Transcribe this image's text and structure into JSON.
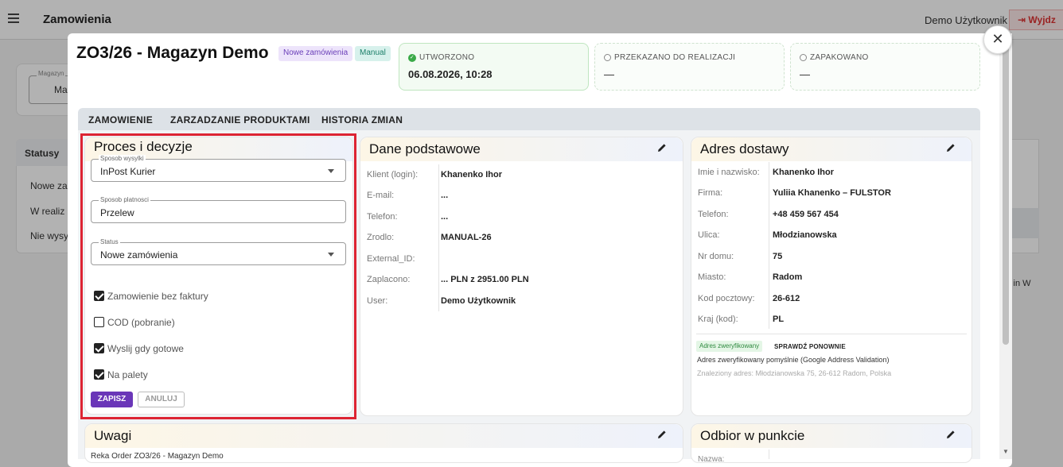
{
  "app": {
    "title": "Zamowienia",
    "user": "Demo Użytkownik",
    "logout": "Wyjdz",
    "bg_field_label": "Magazyn",
    "bg_field_value": "Ma",
    "statuses_title": "Statusy",
    "statuses": [
      "Nowe za",
      "W realiz",
      "Nie wysy"
    ],
    "bg_right_text": "ma d in W"
  },
  "modal": {
    "title": "ZO3/26 - Magazyn Demo",
    "chips": {
      "status": "Nowe zamówienia",
      "source": "Manual"
    },
    "close": "✕",
    "steps": [
      {
        "label": "UTWORZONO",
        "value": "06.08.2026, 10:28"
      },
      {
        "label": "PRZEKAZANO DO REALIZACJI",
        "value": "—"
      },
      {
        "label": "ZAPAKOWANO",
        "value": "—"
      }
    ],
    "tabs": [
      "ZAMOWIENIE",
      "ZARZADZANIE PRODUKTAMI",
      "HISTORIA ZMIAN"
    ]
  },
  "process": {
    "title": "Proces i decyzje",
    "shipping": {
      "label": "Sposob wysylki",
      "value": "InPost Kurier"
    },
    "payment": {
      "label": "Sposob platnosci",
      "value": "Przelew"
    },
    "status": {
      "label": "Status",
      "value": "Nowe zamówienia"
    },
    "checkboxes": [
      {
        "label": "Zamowienie bez faktury",
        "checked": true
      },
      {
        "label": "COD (pobranie)",
        "checked": false
      },
      {
        "label": "Wyslij gdy gotowe",
        "checked": true
      },
      {
        "label": "Na palety",
        "checked": true
      }
    ],
    "save": "ZAPISZ",
    "cancel": "ANULUJ"
  },
  "basic": {
    "title": "Dane podstawowe",
    "rows": [
      {
        "key": "Klient (login):",
        "value": "Khanenko Ihor"
      },
      {
        "key": "E-mail:",
        "value": "..."
      },
      {
        "key": "Telefon:",
        "value": "..."
      },
      {
        "key": "Zrodlo:",
        "value": "MANUAL-26"
      },
      {
        "key": "External_ID:",
        "value": ""
      },
      {
        "key": "Zaplacono:",
        "value": "... PLN z 2951.00 PLN"
      },
      {
        "key": "User:",
        "value": "Demo Użytkownik"
      }
    ]
  },
  "address": {
    "title": "Adres dostawy",
    "rows": [
      {
        "key": "Imie i nazwisko:",
        "value": "Khanenko Ihor"
      },
      {
        "key": "Firma:",
        "value": "Yuliia Khanenko – FULSTOR"
      },
      {
        "key": "Telefon:",
        "value": "+48 459 567 454"
      },
      {
        "key": "Ulica:",
        "value": "Młodzianowska"
      },
      {
        "key": "Nr domu:",
        "value": "75"
      },
      {
        "key": "Miasto:",
        "value": "Radom"
      },
      {
        "key": "Kod pocztowy:",
        "value": "26-612"
      },
      {
        "key": "Kraj (kod):",
        "value": "PL"
      }
    ],
    "verified_chip": "Adres zweryfikowany",
    "recheck": "SPRAWDŹ PONOWNIE",
    "verified_msg": "Adres zweryfikowany pomyślnie (Google Address Validation)",
    "found": "Znaleziony adres: Młodzianowska 75, 26-612 Radom, Polska"
  },
  "notes": {
    "title": "Uwagi",
    "text": "Reka Order ZO3/26 - Magazyn Demo"
  },
  "pickup": {
    "title": "Odbior w punkcie",
    "key": "Nazwa:"
  },
  "colors": {
    "accent": "#6a36b8",
    "highlight": "#dd2433",
    "ok": "#3aaa48"
  }
}
